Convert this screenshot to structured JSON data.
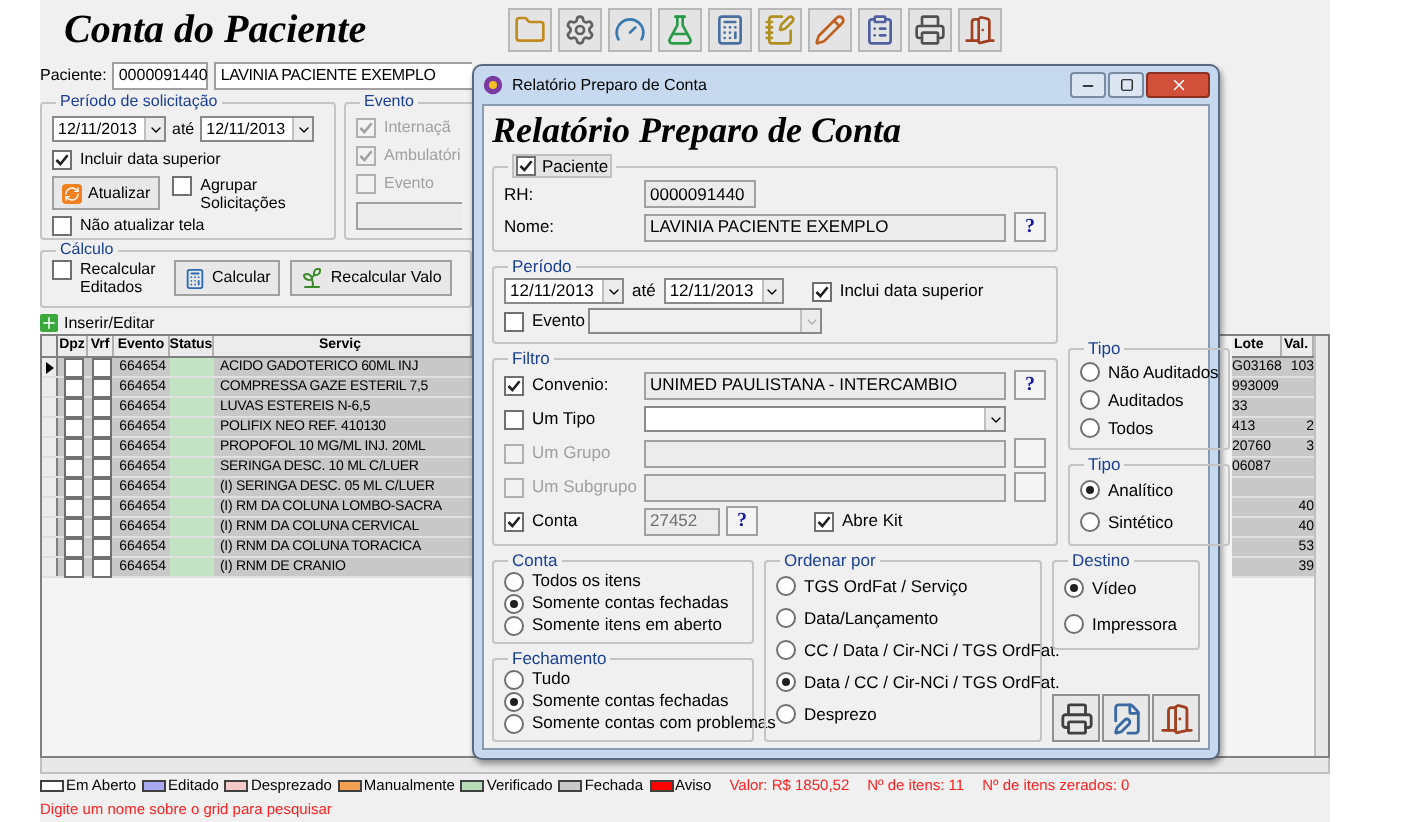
{
  "app": {
    "title": "Conta do Paciente"
  },
  "patient": {
    "label": "Paciente:",
    "rh": "0000091440",
    "name": "LAVINIA PACIENTE EXEMPLO"
  },
  "left_period": {
    "title": "Período de solicitação",
    "from": "12/11/2013",
    "until": "até",
    "to": "12/11/2013",
    "include": {
      "label": "Incluir data superior",
      "checked": true
    },
    "refresh_button": "Atualizar",
    "group": {
      "label": "Agrupar Solicitações",
      "checked": false
    },
    "no_refresh": {
      "label": "Não atualizar tela",
      "checked": false
    }
  },
  "event_box": {
    "title": "Evento",
    "options": [
      {
        "label": "Internaçã",
        "checked": true,
        "disabled": true
      },
      {
        "label": "Ambulatóri",
        "checked": true,
        "disabled": true
      },
      {
        "label": "Evento",
        "checked": false,
        "disabled": true
      }
    ]
  },
  "calc": {
    "title": "Cálculo",
    "recalc": {
      "label": "Recalcular Editados",
      "checked": false
    },
    "buttons": [
      "Calcular",
      "Recalcular Valo"
    ]
  },
  "grid": {
    "toolbar": "Inserir/Editar",
    "columns": [
      "Dpz",
      "Vrf",
      "Evento",
      "Status",
      "Serviç"
    ],
    "right_columns": [
      "Lote",
      "Val."
    ],
    "rows": [
      {
        "selected": true,
        "dpz": false,
        "vrf": false,
        "event": "664654",
        "color": "#c4e2c4",
        "service": "ACIDO GADOTERICO 60ML INJ",
        "lot": "G03168",
        "value": "103"
      },
      {
        "selected": false,
        "dpz": false,
        "vrf": false,
        "event": "664654",
        "color": "#c4e2c4",
        "service": "COMPRESSA GAZE ESTERIL 7,5",
        "lot": "993009",
        "value": ""
      },
      {
        "selected": false,
        "dpz": false,
        "vrf": false,
        "event": "664654",
        "color": "#c4e2c4",
        "service": "LUVAS ESTEREIS N-6,5",
        "lot": "33",
        "value": ""
      },
      {
        "selected": false,
        "dpz": false,
        "vrf": false,
        "event": "664654",
        "color": "#c4e2c4",
        "service": "POLIFIX   NEO   REF. 410130",
        "lot": "413",
        "value": "2"
      },
      {
        "selected": false,
        "dpz": false,
        "vrf": false,
        "event": "664654",
        "color": "#c4e2c4",
        "service": "PROPOFOL 10 MG/ML INJ. 20ML",
        "lot": "20760",
        "value": "3"
      },
      {
        "selected": false,
        "dpz": false,
        "vrf": false,
        "event": "664654",
        "color": "#c4e2c4",
        "service": "SERINGA DESC. 10 ML C/LUER",
        "lot": "06087",
        "value": ""
      },
      {
        "selected": false,
        "dpz": false,
        "vrf": false,
        "event": "664654",
        "color": "#c4e2c4",
        "service": "(I) SERINGA DESC. 05 ML C/LUER",
        "lot": "",
        "value": ""
      },
      {
        "selected": false,
        "dpz": false,
        "vrf": false,
        "event": "664654",
        "color": "#c4e2c4",
        "service": "(I) RM DA COLUNA LOMBO-SACRA",
        "lot": "",
        "value": "40"
      },
      {
        "selected": false,
        "dpz": false,
        "vrf": false,
        "event": "664654",
        "color": "#c4e2c4",
        "service": "(I) RNM DA COLUNA CERVICAL",
        "lot": "",
        "value": "40"
      },
      {
        "selected": false,
        "dpz": false,
        "vrf": false,
        "event": "664654",
        "color": "#c4e2c4",
        "service": "(I) RNM DA COLUNA TORACICA",
        "lot": "",
        "value": "53"
      },
      {
        "selected": false,
        "dpz": false,
        "vrf": false,
        "event": "664654",
        "color": "#c4e2c4",
        "service": "(I) RNM DE CRANIO",
        "lot": "",
        "value": "39"
      }
    ]
  },
  "legend": [
    {
      "label": "Em Aberto",
      "color": "#ffffff"
    },
    {
      "label": "Editado",
      "color": "#a8a8f0"
    },
    {
      "label": "Desprezado",
      "color": "#f4c8c8"
    },
    {
      "label": "Manualmente",
      "color": "#f0a050"
    },
    {
      "label": "Verificado",
      "color": "#b8dcb8"
    },
    {
      "label": "Fechada",
      "color": "#c8c8c8"
    },
    {
      "label": "Aviso",
      "color": "#ff0000"
    }
  ],
  "totals": [
    "Valor: R$ 1850,52",
    "Nº de itens: 11",
    "Nº de itens zerados: 0"
  ],
  "hint": "Digite um nome sobre o grid para pesquisar",
  "dialog": {
    "title": "Relatório Preparo de Conta",
    "heading": "Relatório Preparo de Conta",
    "patient": {
      "title": "Paciente",
      "checked": true,
      "rh_label": "RH:",
      "rh": "0000091440",
      "name_label": "Nome:",
      "name": "LAVINIA PACIENTE EXEMPLO",
      "lookup": "?"
    },
    "period": {
      "title": "Período",
      "from": "12/11/2013",
      "until": "até",
      "to": "12/11/2013",
      "include": {
        "label": "Inclui data superior",
        "checked": true
      },
      "event": {
        "label": "Evento",
        "checked": false
      }
    },
    "filter": {
      "title": "Filtro",
      "rows": [
        {
          "kind": "lookup",
          "label": "Convenio:",
          "checked": true,
          "disabled": false,
          "value": "UNIMED PAULISTANA - INTERCAMBIO",
          "button": "?"
        },
        {
          "kind": "combo",
          "label": "Um Tipo",
          "checked": false,
          "disabled": false
        },
        {
          "kind": "lookup",
          "label": "Um Grupo",
          "checked": false,
          "disabled": true
        },
        {
          "kind": "lookup",
          "label": "Um Subgrupo",
          "checked": false,
          "disabled": true
        },
        {
          "kind": "account",
          "label": "Conta",
          "checked": true,
          "disabled": false,
          "value": "27452",
          "button": "?",
          "kit": {
            "label": "Abre Kit",
            "checked": true
          }
        }
      ]
    },
    "audit_type": {
      "title": "Tipo",
      "options": [
        {
          "label": "Não Auditados",
          "selected": false
        },
        {
          "label": "Auditados",
          "selected": false
        },
        {
          "label": "Todos",
          "selected": false
        }
      ]
    },
    "report_type": {
      "title": "Tipo",
      "options": [
        {
          "label": "Analítico",
          "selected": true
        },
        {
          "label": "Sintético",
          "selected": false
        }
      ]
    },
    "account": {
      "title": "Conta",
      "options": [
        {
          "label": "Todos os itens",
          "selected": false
        },
        {
          "label": "Somente contas fechadas",
          "selected": true
        },
        {
          "label": "Somente itens em aberto",
          "selected": false
        }
      ]
    },
    "closing": {
      "title": "Fechamento",
      "options": [
        {
          "label": "Tudo",
          "selected": false
        },
        {
          "label": "Somente contas fechadas",
          "selected": true
        },
        {
          "label": "Somente contas com problemas",
          "selected": false
        }
      ]
    },
    "order": {
      "title": "Ordenar por",
      "options": [
        {
          "label": "TGS OrdFat / Serviço",
          "selected": false
        },
        {
          "label": "Data/Lançamento",
          "selected": false
        },
        {
          "label": "CC / Data / Cir-NCi / TGS OrdFat.",
          "selected": false
        },
        {
          "label": "Data / CC / Cir-NCi / TGS OrdFat.",
          "selected": true
        },
        {
          "label": "Desprezo",
          "selected": false
        }
      ]
    },
    "destination": {
      "title": "Destino",
      "options": [
        {
          "label": "Vídeo",
          "selected": true
        },
        {
          "label": "Impressora",
          "selected": false
        }
      ]
    }
  }
}
